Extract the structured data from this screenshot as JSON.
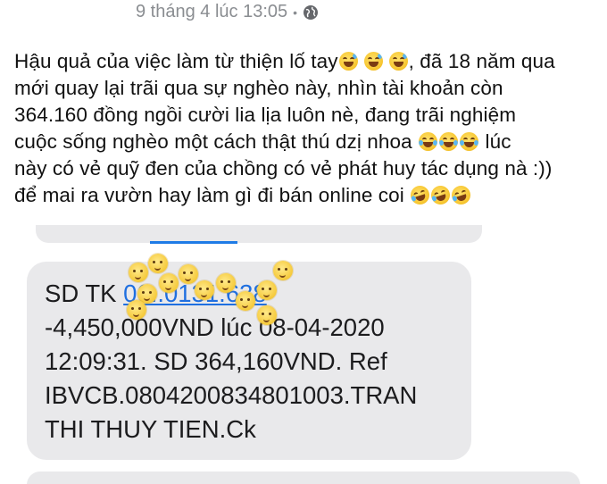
{
  "post": {
    "date": "9 tháng 4 lúc 13:05",
    "separator": "•",
    "privacy_icon": "globe-icon",
    "lines": {
      "l1a": "Hậu quả của việc làm từ thiện lố tay",
      "l1b": ", đã 18 năm qua",
      "l2": "mới quay lại trãi qua sự nghèo này, nhìn tài khoản còn",
      "l3": "364.160 đồng ngồi cười lia lịa luôn nè, đang trãi nghiệm",
      "l4a": "cuộc sống nghèo một cách thật thú dzị nhoa",
      "l4b": " lúc",
      "l5": "này có vẻ quỹ đen của chồng có vẻ phát huy tác dụng nà :))",
      "l6": "để mai ra vườn hay làm gì đi bán online coi"
    },
    "emojis": {
      "sweat_smile": "grinning-sweat-emoji",
      "tears_of_joy": "tears-of-joy-emoji",
      "rofl": "rolling-on-floor-laughing-emoji"
    }
  },
  "sms": {
    "line1_prefix": "SD TK ",
    "line1_link": "06..0131.638",
    "line2": "-4,450,000VND lúc 08-04-2020",
    "line3": "12:09:31. SD 364,160VND. Ref",
    "line4": "IBVCB.0804200834801003.TRAN",
    "line5": "THI THUY TIEN.Ck"
  },
  "overlay": {
    "sticker_icon": "laughing-sticker-icon"
  },
  "colors": {
    "bubble": "#e9e9eb",
    "link": "#1f6fe0",
    "meta": "#8a8d91"
  }
}
